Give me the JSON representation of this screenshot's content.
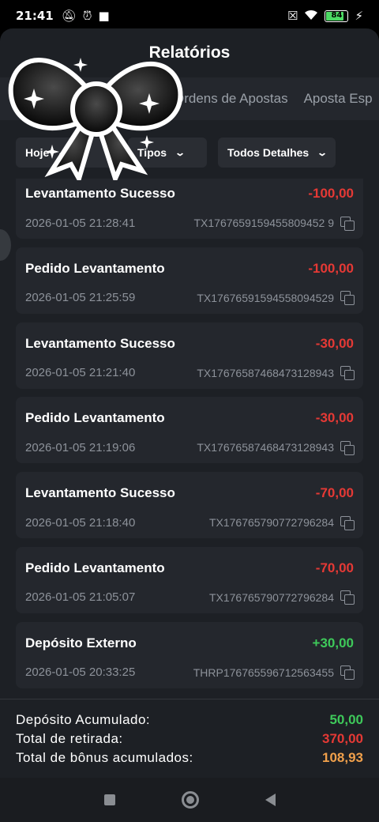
{
  "status_bar": {
    "time": "21:41",
    "left_icons": [
      "mute-bell-icon",
      "alarm-icon",
      "video-camera-icon"
    ],
    "right_icons": [
      "no-sim-icon",
      "wifi-icon",
      "battery-icon",
      "charging-icon"
    ],
    "battery_level": "84"
  },
  "header": {
    "title": "Relatórios"
  },
  "tabs": [
    {
      "label": "Ordens de Apostas"
    },
    {
      "label": "Aposta Esp"
    }
  ],
  "filters": [
    {
      "label": "Hoje"
    },
    {
      "label": "Tipos"
    },
    {
      "label": "Todos Detalhes"
    }
  ],
  "transactions": [
    {
      "type": "Levantamento Sucesso",
      "amount": "-100,00",
      "time": "2026-01-05 21:28:41",
      "tx": "TX1767659159455809452 9"
    },
    {
      "type": "Pedido Levantamento",
      "amount": "-100,00",
      "time": "2026-01-05 21:25:59",
      "tx": "TX17676591594558094529"
    },
    {
      "type": "Levantamento Sucesso",
      "amount": "-30,00",
      "time": "2026-01-05 21:21:40",
      "tx": "TX17676587468473128943"
    },
    {
      "type": "Pedido Levantamento",
      "amount": "-30,00",
      "time": "2026-01-05 21:19:06",
      "tx": "TX17676587468473128943"
    },
    {
      "type": "Levantamento Sucesso",
      "amount": "-70,00",
      "time": "2026-01-05 21:18:40",
      "tx": "TX176765790772796284"
    },
    {
      "type": "Pedido Levantamento",
      "amount": "-70,00",
      "time": "2026-01-05 21:05:07",
      "tx": "TX176765790772796284"
    },
    {
      "type": "Depósito Externo",
      "amount": "+30,00",
      "time": "2026-01-05 20:33:25",
      "tx": "THRP176765596712563455"
    }
  ],
  "summary": {
    "deposit_label": "Depósito Acumulado:",
    "deposit_value": "50,00",
    "withdraw_label": "Total de retirada:",
    "withdraw_value": "370,00",
    "bonus_label": "Total de bônus acumulados:",
    "bonus_value": "108,93"
  },
  "colors": {
    "negative": "#e53935",
    "positive": "#3ec95a",
    "bonus": "#f0a04b",
    "background": "#1d2025",
    "card": "#24272d"
  }
}
